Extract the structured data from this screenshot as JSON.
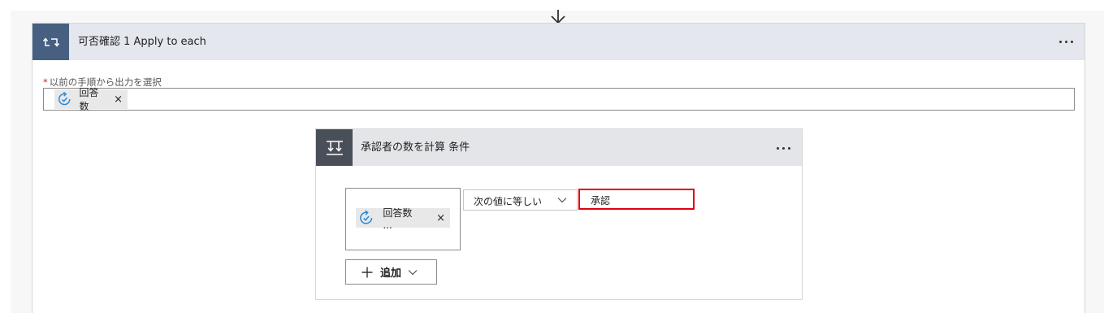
{
  "outer_loop": {
    "title": "可否確認 1 Apply to each",
    "field_label_required": "*",
    "field_label": "以前の手順から出力を選択",
    "token": {
      "label": "回答数",
      "close": "×"
    }
  },
  "inner_condition": {
    "title": "承認者の数を計算 条件",
    "left_operand_token": {
      "label": "回答数 ...",
      "close": "×"
    },
    "operator": "次の値に等しい",
    "value": "承認",
    "add_button_label": "追加"
  },
  "colors": {
    "loop_header_accent": "#476081",
    "condition_header_accent": "#484f58",
    "highlight_border": "#e3000f",
    "token_icon": "#2b88d8"
  },
  "icons": {
    "flow_arrow": "arrow-down-icon",
    "loop": "loop-icon",
    "condition": "condition-icon",
    "token": "flow-token-icon",
    "more": "more-icon",
    "chevron": "chevron-down-icon",
    "plus": "plus-icon",
    "close": "close-icon"
  }
}
